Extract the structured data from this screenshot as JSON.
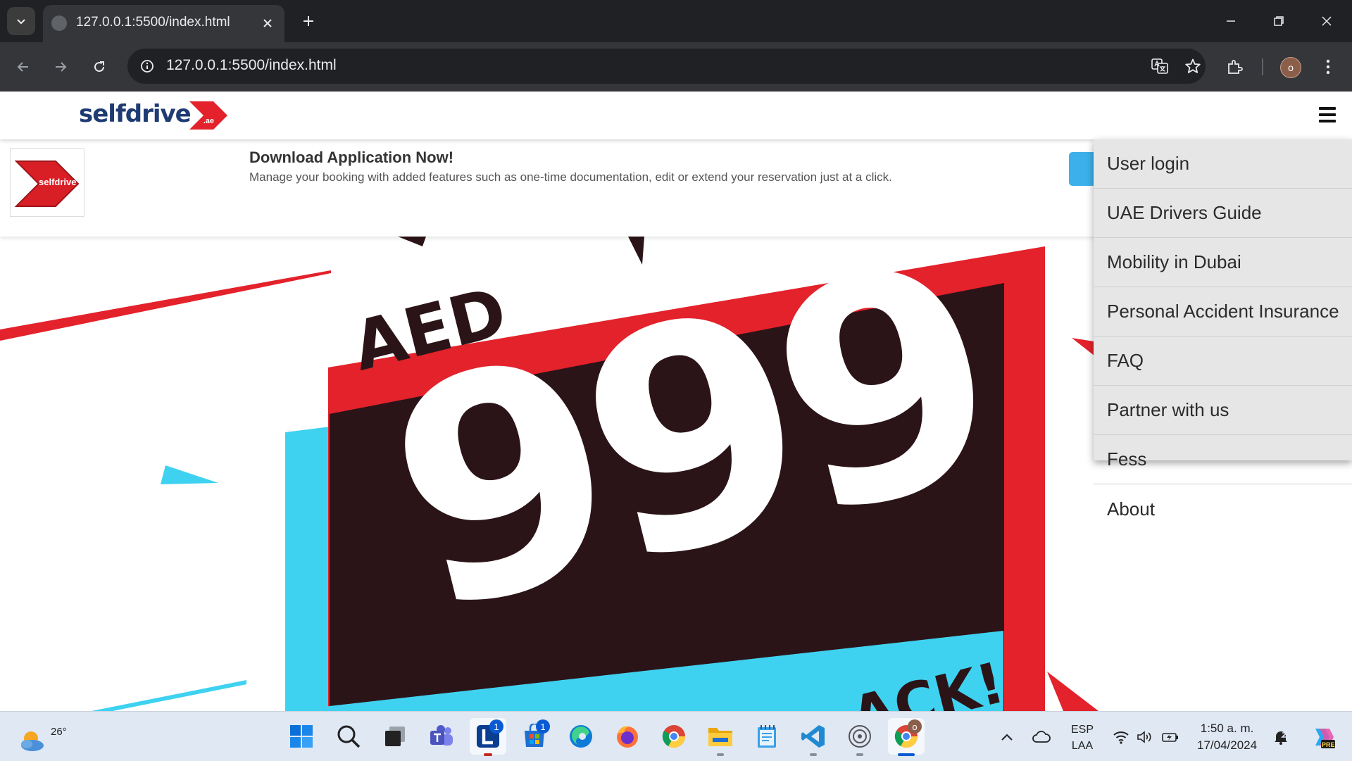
{
  "browser": {
    "tab_title": "127.0.0.1:5500/index.html",
    "url": "127.0.0.1:5500/index.html",
    "profile_initial": "o"
  },
  "site": {
    "logo_text": "selfdrive",
    "logo_suffix": ".ae",
    "app_icon_text": "selfdrive",
    "banner": {
      "title": "Download Application Now!",
      "description": "Manage your booking with added features such as one-time documentation, edit or extend your reservation just at a click."
    },
    "promo": {
      "currency": "AED",
      "price": "999",
      "partial_text": "ACK!"
    },
    "menu": [
      {
        "label": "User login"
      },
      {
        "label": "UAE Drivers Guide"
      },
      {
        "label": "Mobility in Dubai"
      },
      {
        "label": "Personal Accident Insurance"
      },
      {
        "label": "FAQ"
      },
      {
        "label": "Partner with us"
      },
      {
        "label": "Fess"
      },
      {
        "label": "About"
      }
    ]
  },
  "taskbar": {
    "weather_temp": "26°",
    "badges": {
      "app_l": "1",
      "store": "1",
      "chrome": "o"
    },
    "language": {
      "line1": "ESP",
      "line2": "LAA"
    },
    "time": "1:50 a. m.",
    "date": "17/04/2024",
    "copilot_badge": "PRE"
  },
  "colors": {
    "brand_red": "#e3222b",
    "brand_navy": "#1f3b73",
    "promo_dark": "#2b1418",
    "promo_cyan": "#3fd2f0",
    "chrome_dark": "#202124"
  }
}
